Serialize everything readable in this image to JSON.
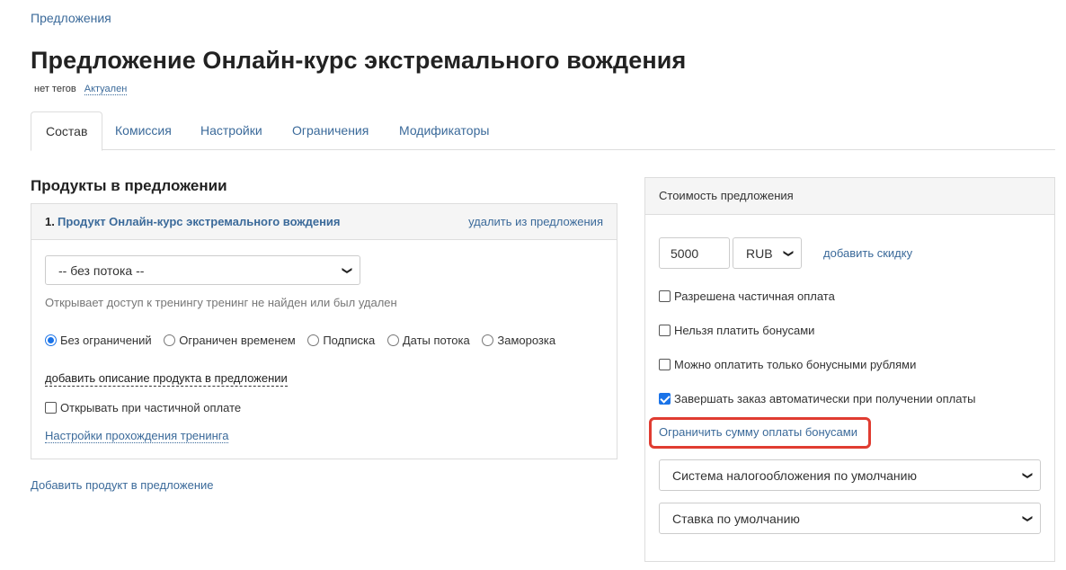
{
  "breadcrumb": "Предложения",
  "title": "Предложение Онлайн-курс экстремального вождения",
  "meta": {
    "tags": "нет тегов",
    "status": "Актуален"
  },
  "tabs": [
    {
      "label": "Состав",
      "active": true
    },
    {
      "label": "Комиссия"
    },
    {
      "label": "Настройки"
    },
    {
      "label": "Ограничения"
    },
    {
      "label": "Модификаторы"
    }
  ],
  "products": {
    "heading": "Продукты в предложении",
    "item": {
      "number": "1.",
      "name": "Продукт Онлайн-курс экстремального вождения",
      "remove_label": "удалить из предложения",
      "stream_select": "-- без потока --",
      "access_note": "Открывает доступ к тренингу тренинг не найден или был удален",
      "access_options": [
        {
          "label": "Без ограничений",
          "checked": true
        },
        {
          "label": "Ограничен временем",
          "checked": false
        },
        {
          "label": "Подписка",
          "checked": false
        },
        {
          "label": "Даты потока",
          "checked": false
        },
        {
          "label": "Заморозка",
          "checked": false
        }
      ],
      "add_description": "добавить описание продукта в предложении",
      "open_on_partial": "Открывать при частичной оплате",
      "training_settings": "Настройки прохождения тренинга"
    },
    "add_product": "Добавить продукт в предложение"
  },
  "pricing": {
    "heading": "Стоимость предложения",
    "price": "5000",
    "currency": "RUB",
    "add_discount": "добавить скидку",
    "options": [
      {
        "label": "Разрешена частичная оплата",
        "checked": false
      },
      {
        "label": "Нельзя платить бонусами",
        "checked": false
      },
      {
        "label": "Можно оплатить только бонусными рублями",
        "checked": false
      },
      {
        "label": "Завершать заказ автоматически при получении оплаты",
        "checked": true
      }
    ],
    "limit_bonus_link": "Ограничить сумму оплаты бонусами",
    "tax_system": "Система налогообложения по умолчанию",
    "rate": "Ставка по умолчанию"
  },
  "colors": {
    "link": "#3b6a9a",
    "highlight": "#e03c31",
    "checkbox": "#1a73e8"
  }
}
